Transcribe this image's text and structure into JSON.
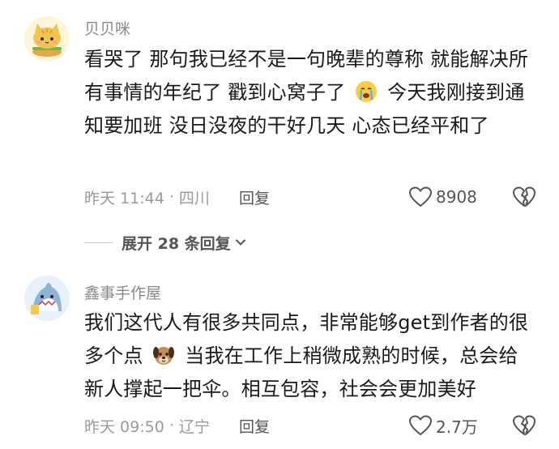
{
  "comments": [
    {
      "username": "贝贝咪",
      "text_parts": [
        "看哭了 那句我已经不是一句晚辈的尊称 就能解决所有事情的年纪了 戳到心窝子了",
        "今天我刚接到通知要加班 没日没夜的干好几天 心态已经平和了"
      ],
      "time": "昨天 11:44",
      "location": "四川",
      "reply_label": "回复",
      "likes": "8908",
      "expand_label": "展开 28 条回复"
    },
    {
      "username": "鑫事手作屋",
      "text_parts": [
        "我们这代人有很多共同点，非常能够get到作者的很多个点",
        "当我在工作上稍微成熟的时候，总会给新人撑起一把伞。相互包容，社会会更加美好"
      ],
      "time": "昨天 09:50",
      "location": "辽宁",
      "reply_label": "回复",
      "likes": "2.7万"
    }
  ],
  "icons": {
    "avatar_1": "cat-burger-avatar",
    "avatar_2": "shark-avatar",
    "emoji_1": "crying-face-emoji",
    "emoji_2": "dog-face-emoji",
    "like": "heart-outline-icon",
    "dislike": "broken-heart-icon",
    "expand": "chevron-down-icon"
  },
  "colors": {
    "text": "#1a1a1a",
    "meta": "#9a9a9a",
    "action": "#555555"
  }
}
